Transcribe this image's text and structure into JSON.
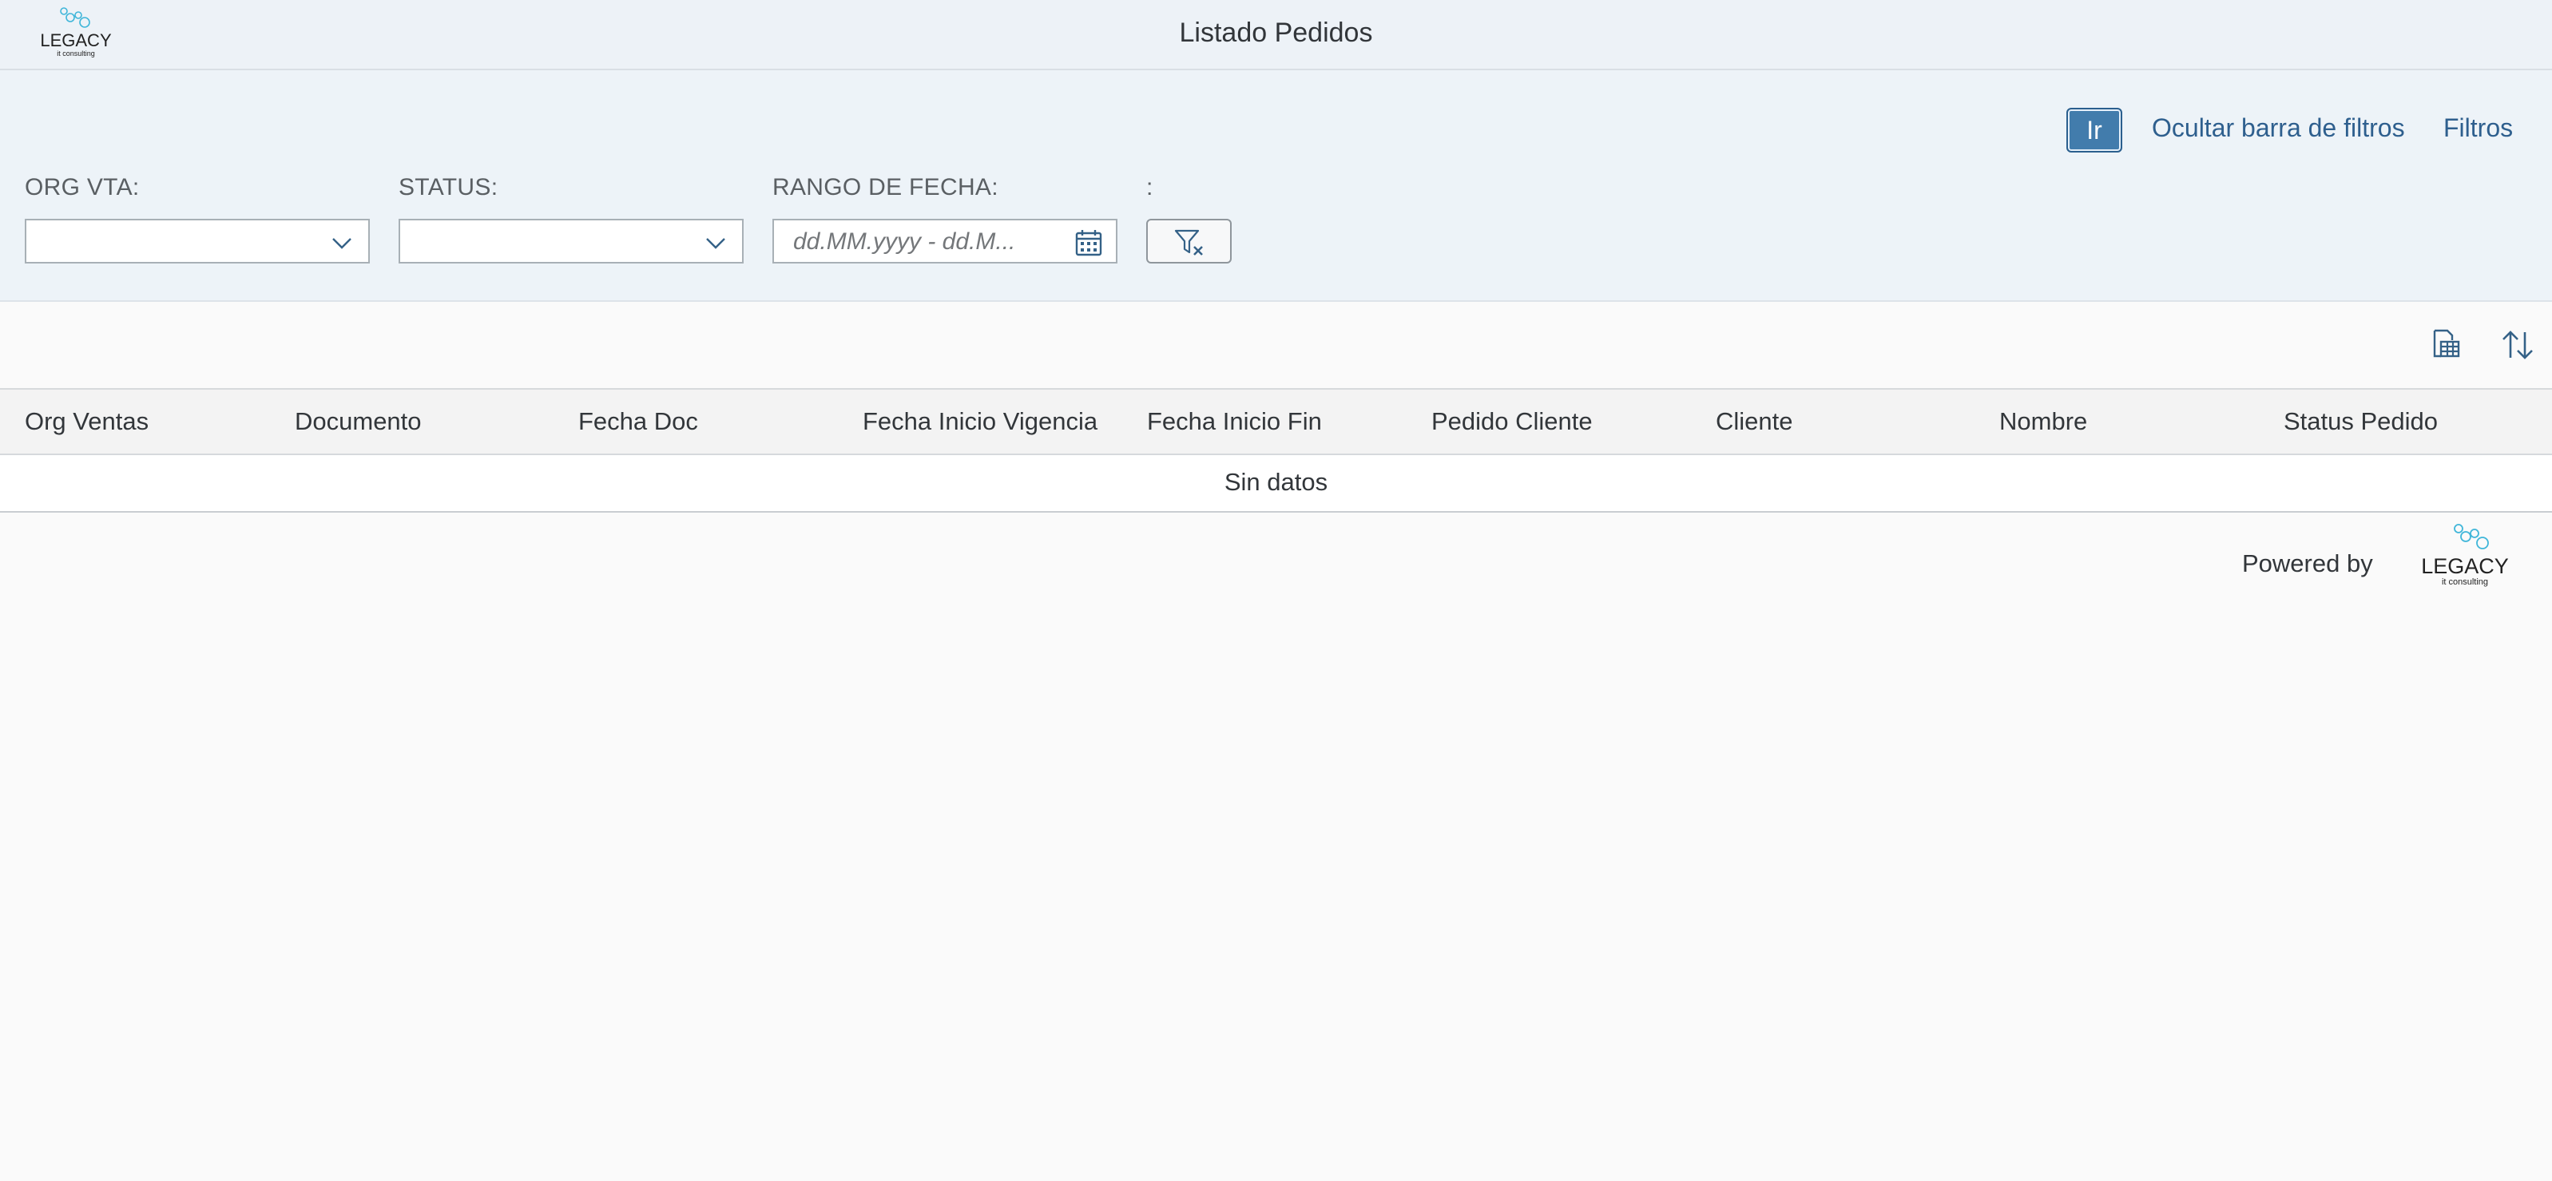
{
  "header": {
    "title": "Listado Pedidos",
    "logo_text": "LEGACY",
    "logo_subtext": "it consulting"
  },
  "filterbar": {
    "go_label": "Ir",
    "hide_label": "Ocultar barra de filtros",
    "filters_label": "Filtros",
    "fields": [
      {
        "label": "ORG VTA:",
        "value": ""
      },
      {
        "label": "STATUS:",
        "value": ""
      },
      {
        "label": "RANGO DE FECHA:",
        "placeholder": "dd.MM.yyyy - dd.M..."
      },
      {
        "label": ":"
      }
    ]
  },
  "table": {
    "columns": [
      "Org Ventas",
      "Documento",
      "Fecha Doc",
      "Fecha Inicio Vigencia",
      "Fecha Inicio Fin",
      "Pedido Cliente",
      "Cliente",
      "Nombre",
      "Status Pedido"
    ],
    "no_data": "Sin datos"
  },
  "footer": {
    "powered_by": "Powered by",
    "logo_text": "LEGACY",
    "logo_subtext": "it consulting"
  },
  "colors": {
    "accent": "#427cac",
    "link": "#2e5f8e",
    "logo_bubbles": "#3fb6d9"
  },
  "icons": [
    "chevron-down-icon",
    "calendar-icon",
    "clear-filter-icon",
    "table-settings-icon",
    "sort-icon"
  ]
}
